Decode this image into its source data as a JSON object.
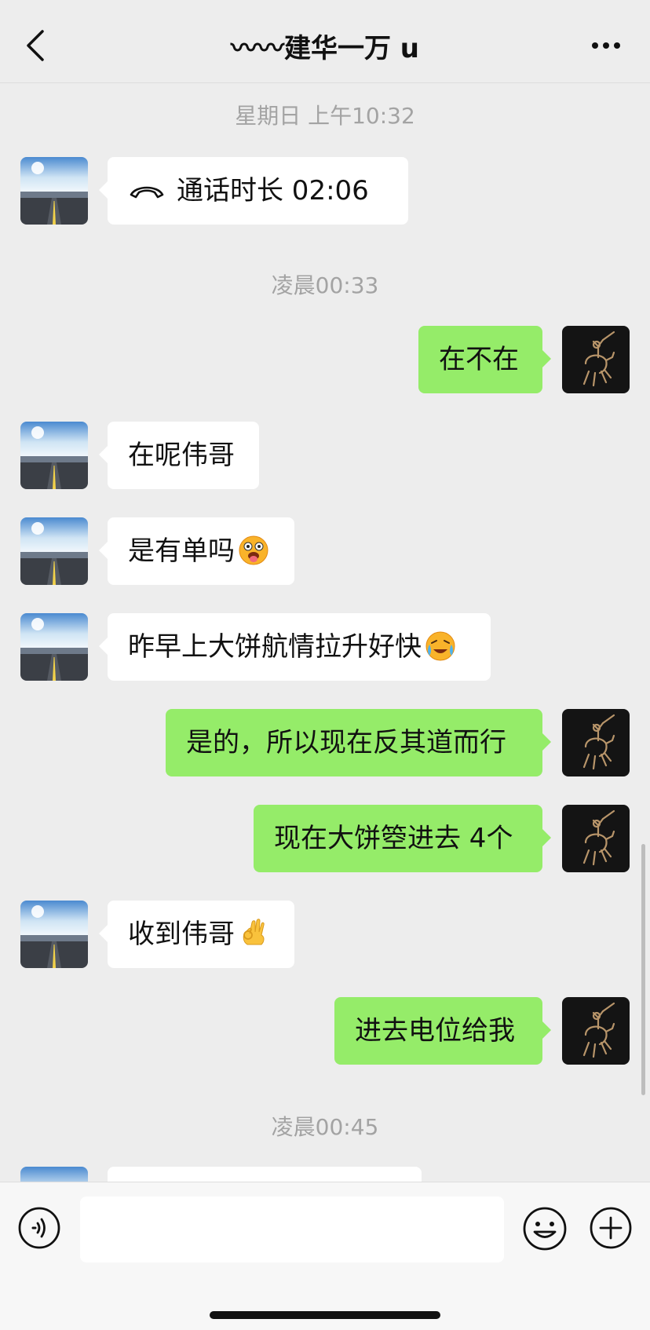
{
  "header": {
    "title": "〰〰建华一万 u"
  },
  "messages": {
    "ts1": "星期日 上午10:32",
    "call_text": "通话时长 02:06",
    "ts2": "凌晨00:33",
    "m1": "在不在",
    "m2": "在呢伟哥",
    "m3": "是有单吗",
    "m4": "昨早上大饼航情拉升好快",
    "m5": "是的，所以现在反其道而行",
    "m6": "现在大饼箜进去 4个",
    "m7": "收到伟哥",
    "m8": "进去电位给我",
    "ts3": "凌晨00:45"
  },
  "input": {
    "placeholder": ""
  },
  "colors": {
    "background": "#ededed",
    "sent_bubble": "#95ec69",
    "received_bubble": "#ffffff",
    "timestamp": "#a3a3a3"
  },
  "icons": {
    "back": "chevron-left-icon",
    "more": "more-dots-icon",
    "call": "phone-hangup-icon",
    "voice": "voice-icon",
    "emoji": "smiley-icon",
    "plus": "plus-icon"
  }
}
